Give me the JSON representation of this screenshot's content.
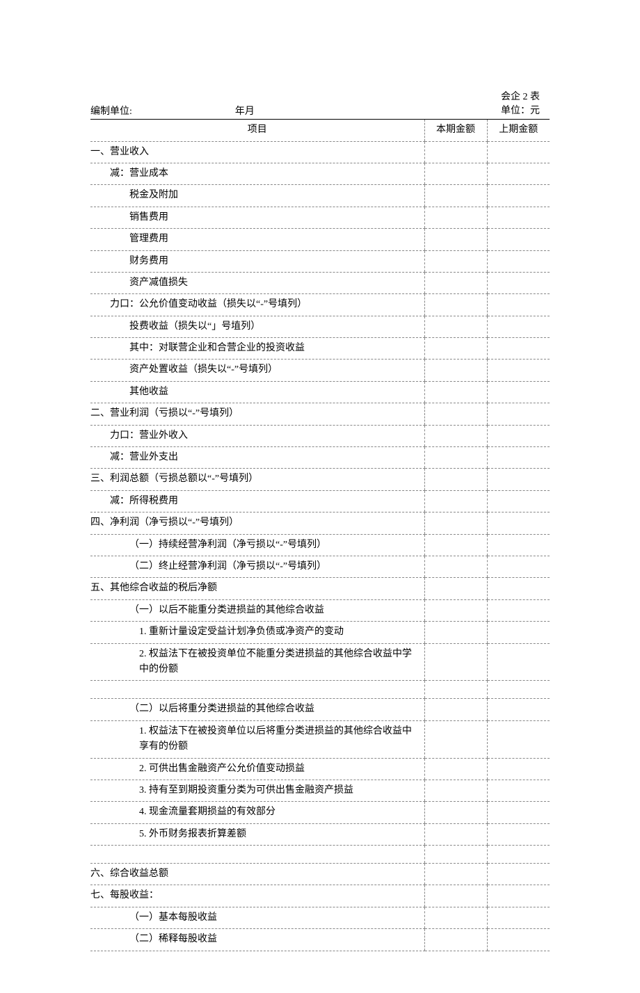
{
  "header": {
    "form_number": "会企 2 表",
    "unit_label": "单位：元",
    "prepared_by_label": "编制单位:",
    "date_label": "年月"
  },
  "columns": {
    "item": "项目",
    "current": "本期金额",
    "prev": "上期金额"
  },
  "rows": [
    {
      "label": "一、营业收入",
      "indent": 0
    },
    {
      "label": "减：营业成本",
      "indent": 1
    },
    {
      "label": "税金及附加",
      "indent": 2
    },
    {
      "label": "销售费用",
      "indent": 2
    },
    {
      "label": "管理费用",
      "indent": 2
    },
    {
      "label": "财务费用",
      "indent": 2
    },
    {
      "label": "资产减值损失",
      "indent": 2
    },
    {
      "label": "力口：公允价值变动收益（损失以“-”号填列）",
      "indent": 1
    },
    {
      "label": "投费收益（损失以“」号埴列）",
      "indent": 2
    },
    {
      "label": " 其中：对联营企业和合营企业的投资收益",
      "indent": 2
    },
    {
      "label": "资产处置收益（损失以“-”号填列）",
      "indent": 2
    },
    {
      "label": "其他收益",
      "indent": 2
    },
    {
      "label": "二、营业利润（亏损以“-”号填列）",
      "indent": 0
    },
    {
      "label": "力口：营业外收入",
      "indent": 1
    },
    {
      "label": "减：营业外支出",
      "indent": 1
    },
    {
      "label": "三、利润总额（亏损总额以“-”号填列）",
      "indent": 0
    },
    {
      "label": "减：所得税费用",
      "indent": 1
    },
    {
      "label": "四、净利润（净亏损以“-”号填列）",
      "indent": 0
    },
    {
      "label": "（一）持续经营净利润（净亏损以“-”号填列）",
      "indent": 2
    },
    {
      "label": "（二）终止经营净利润（净亏损以“-”号填列）",
      "indent": 2
    },
    {
      "label": "五、其他综合收益的税后净额",
      "indent": 0
    },
    {
      "label": "（一）以后不能重分类进损益的其他综合收益",
      "indent": 2
    },
    {
      "label": "1. 重新计量设定受益计划净负债或净资产的变动",
      "indent": 3
    },
    {
      "label": "2. 权益法下在被投资单位不能重分类进损益的其他综合收益中学中的份额",
      "indent": 3,
      "tall": true
    },
    {
      "label": "",
      "indent": 0
    },
    {
      "label": "（二）以后将重分类进损益的其他综合收益",
      "indent": 2
    },
    {
      "label": "1. 权益法下在被投资单位以后将重分类进损益的其他综合收益中享有的份额",
      "indent": 3,
      "tall": true
    },
    {
      "label": "2. 可供出售金融资产公允价值变动损益",
      "indent": 3
    },
    {
      "label": "3. 持有至到期投资重分类为可供出售金融资产损益",
      "indent": 3
    },
    {
      "label": "4. 现金流量套期损益的有效部分",
      "indent": 3
    },
    {
      "label": "5. 外币财务报表折算差额",
      "indent": 3
    },
    {
      "label": "",
      "indent": 0
    },
    {
      "label": "六、综合收益总额",
      "indent": 0
    },
    {
      "label": "七、每股收益：",
      "indent": 0
    },
    {
      "label": "（一）基本每股收益",
      "indent": 2
    },
    {
      "label": "（二）稀释每股收益",
      "indent": 2
    }
  ]
}
